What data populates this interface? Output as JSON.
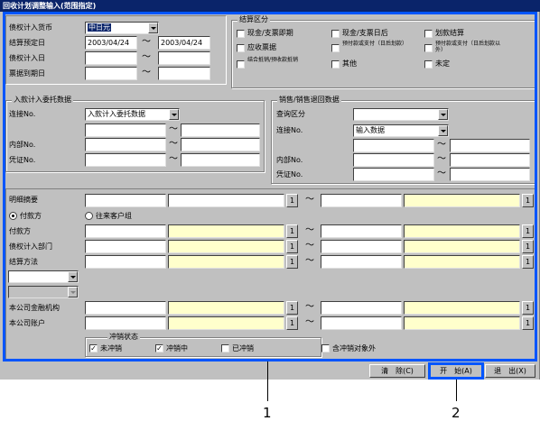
{
  "window": {
    "title": "回收计划调整输入(范围指定)"
  },
  "top": {
    "currency_label": "债权计入货币",
    "currency_value": "中日元",
    "settle_date_label": "结算预定日",
    "settle_date_from": "2003/04/24",
    "settle_date_to": "2003/04/24",
    "claim_date_label": "债权计入日",
    "bill_due_label": "票据到期日",
    "tilde": "～"
  },
  "settlement_type": {
    "title": "结算区分",
    "options": [
      "现金/支票即期",
      "现金/支票日后",
      "划款结算",
      "应收票据",
      "预付款或支付（日后划款）",
      "预付款或支付（日后划款以外）",
      "结合抵销/预收款抵销",
      "其他",
      "未定"
    ]
  },
  "deposit": {
    "title": "入款计入委托数据",
    "conn_label": "连接No.",
    "conn_value": "入款计入委托数据",
    "internal_label": "内部No.",
    "voucher_label": "凭证No."
  },
  "sales": {
    "title": "销售/销售退回数据",
    "query_label": "查询区分",
    "conn_label": "连接No.",
    "conn_value": "输入数据",
    "internal_label": "内部No.",
    "voucher_label": "凭证No."
  },
  "detail": {
    "summary_label": "明细摘要",
    "radio_payer": "付款方",
    "radio_customer": "往来客户组",
    "payer_label": "付款方",
    "dept_label": "债权计入部门",
    "method_label": "结算方法",
    "bank_label": "本公司金融机构",
    "account_label": "本公司账户",
    "btn_1": "1"
  },
  "offset": {
    "title": "冲销状态",
    "unoffset": "未冲销",
    "offsetting": "冲销中",
    "offset_done": "已冲销",
    "exclude": "含冲销对象外"
  },
  "footer": {
    "clear": "清　除(C)",
    "start": "开　始(A)",
    "exit": "退　出(X)"
  },
  "callouts": {
    "one": "1",
    "two": "2"
  }
}
